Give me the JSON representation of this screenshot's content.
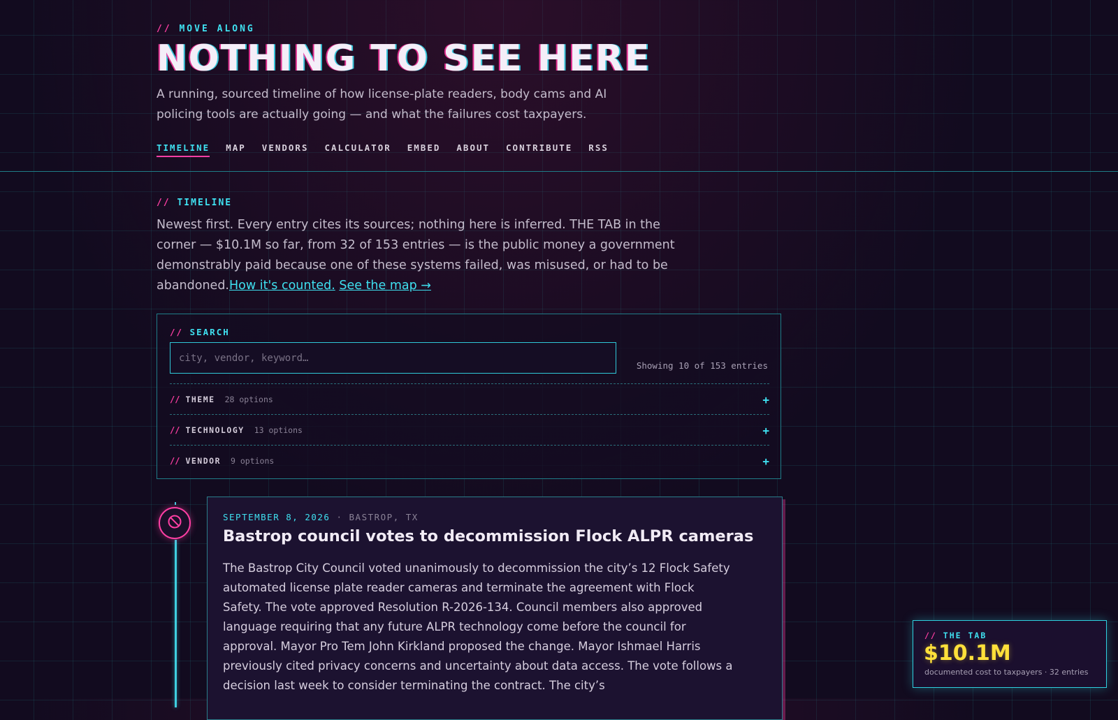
{
  "header": {
    "eyebrow_slash": "//",
    "eyebrow": "MOVE ALONG",
    "title": "NOTHING TO SEE HERE",
    "subtitle": "A running, sourced timeline of how license-plate readers, body cams and AI policing tools are actually going — and what the failures cost taxpayers."
  },
  "nav": {
    "tabs": [
      "TIMELINE",
      "MAP",
      "VENDORS",
      "CALCULATOR",
      "EMBED",
      "ABOUT",
      "CONTRIBUTE",
      "RSS"
    ],
    "active": "TIMELINE"
  },
  "timeline": {
    "eyebrow_slash": "//",
    "eyebrow": "TIMELINE",
    "intro": "Newest first. Every entry cites its sources; nothing here is inferred. THE TAB in the corner — $10.1M so far, from 32 of 153 entries — is the public money a government demonstrably paid because one of these systems failed, was misused, or had to be abandoned.",
    "link_counted": "How it's counted.",
    "link_map": "See the map →"
  },
  "search": {
    "label_slash": "//",
    "label": "SEARCH",
    "placeholder": "city, vendor, keyword…",
    "value": "",
    "showing": "Showing 10 of 153 entries"
  },
  "facets": [
    {
      "slash": "//",
      "name": "THEME",
      "count": "28 options",
      "toggle": "+"
    },
    {
      "slash": "//",
      "name": "TECHNOLOGY",
      "count": "13 options",
      "toggle": "+"
    },
    {
      "slash": "//",
      "name": "VENDOR",
      "count": "9 options",
      "toggle": "+"
    }
  ],
  "entries": [
    {
      "icon": "prohibited-icon",
      "date": "SEPTEMBER 8, 2026",
      "separator": "·",
      "location": "BASTROP, TX",
      "title": "Bastrop council votes to decommission Flock ALPR cameras",
      "body": "The Bastrop City Council voted unanimously to decommission the city’s 12 Flock Safety automated license plate reader cameras and terminate the agreement with Flock Safety. The vote approved Resolution R-2026-134. Council members also approved language requiring that any future ALPR technology come before the council for approval. Mayor Pro Tem John Kirkland proposed the change. Mayor Ishmael Harris previously cited privacy concerns and uncertainty about data access. The vote follows a decision last week to consider terminating the contract. The city’s"
    }
  ],
  "tab": {
    "eyebrow_slash": "//",
    "eyebrow": "THE TAB",
    "amount": "$10.1M",
    "caption": "documented cost to taxpayers · 32 entries"
  },
  "colors": {
    "accent_pink": "#ff3fa4",
    "accent_cyan": "#3fe0f0",
    "amount_yellow": "#ffe03a",
    "background": "#120b1f"
  }
}
